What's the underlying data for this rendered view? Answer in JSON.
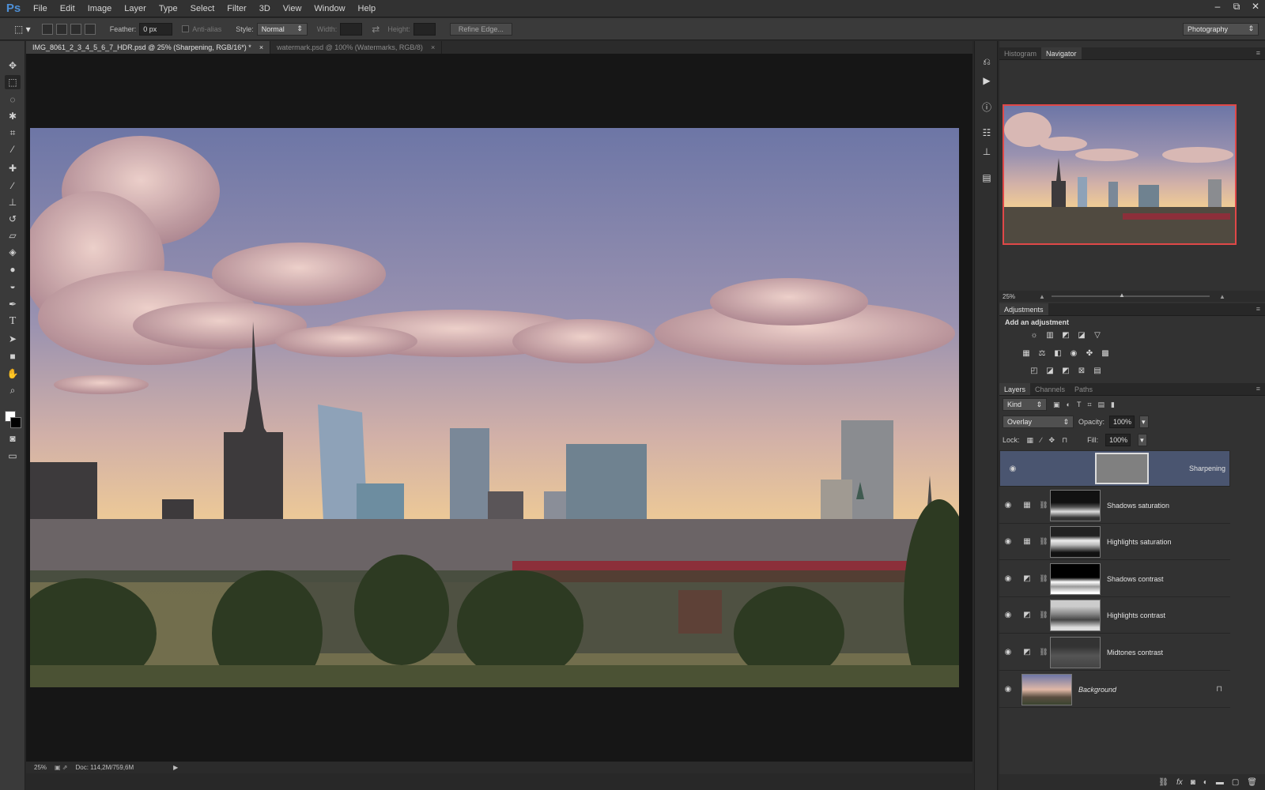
{
  "app": {
    "logo": "Ps"
  },
  "menu": [
    "File",
    "Edit",
    "Image",
    "Layer",
    "Type",
    "Select",
    "Filter",
    "3D",
    "View",
    "Window",
    "Help"
  ],
  "window_controls": [
    "‒",
    "⧉",
    "✕"
  ],
  "options": {
    "feather_label": "Feather:",
    "feather_value": "0 px",
    "antialias_label": "Anti-alias",
    "style_label": "Style:",
    "style_value": "Normal",
    "width_label": "Width:",
    "height_label": "Height:",
    "refine_label": "Refine Edge...",
    "workspace": "Photography"
  },
  "tabs": [
    {
      "label": "IMG_8061_2_3_4_5_6_7_HDR.psd @ 25% (Sharpening, RGB/16*) *",
      "close": "×"
    },
    {
      "label": "watermark.psd @ 100% (Watermarks, RGB/8)",
      "close": "×"
    }
  ],
  "status": {
    "zoom": "25%",
    "doc": "Doc: 114,2M/759,6M"
  },
  "panels": {
    "top_tabs": [
      "Histogram",
      "Navigator"
    ],
    "nav_zoom": "25%",
    "adjustments_title": "Adjustments",
    "add_adjustment": "Add an adjustment",
    "layers_tabs": [
      "Layers",
      "Channels",
      "Paths"
    ],
    "kind_label": "Kind",
    "blend_mode": "Overlay",
    "opacity_label": "Opacity:",
    "opacity_value": "100%",
    "lock_label": "Lock:",
    "fill_label": "Fill:",
    "fill_value": "100%"
  },
  "layers": [
    {
      "name": "Sharpening"
    },
    {
      "name": "Shadows saturation"
    },
    {
      "name": "Highlights saturation"
    },
    {
      "name": "Shadows contrast"
    },
    {
      "name": "Highlights contrast"
    },
    {
      "name": "Midtones contrast"
    },
    {
      "name": "Background"
    }
  ],
  "colors": {
    "accent_selected": "#4a5570",
    "nav_frame": "#e04848",
    "logo": "#4d8fd6"
  },
  "icons": [
    "move-icon",
    "marquee-icon",
    "lasso-icon",
    "magic-wand-icon",
    "crop-icon",
    "eyedropper-icon",
    "healing-icon",
    "brush-icon",
    "stamp-icon",
    "history-brush-icon",
    "eraser-icon",
    "bucket-icon",
    "blur-icon",
    "dodge-icon",
    "pen-icon",
    "type-icon",
    "path-select-icon",
    "shape-icon",
    "hand-icon",
    "zoom-icon"
  ]
}
